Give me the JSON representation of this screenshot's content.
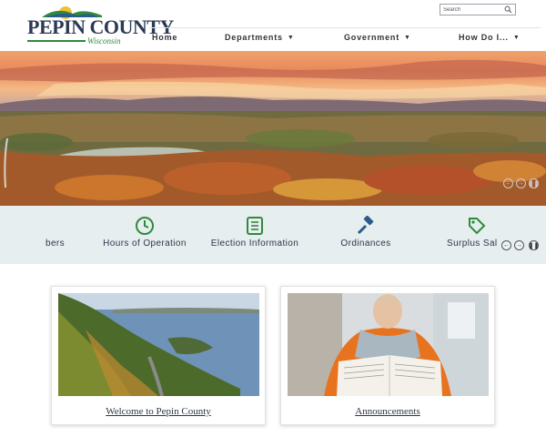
{
  "header": {
    "logo": {
      "title": "PEPIN COUNTY",
      "subtitle": "Wisconsin"
    },
    "search": {
      "placeholder": "Search",
      "icon": "search-icon"
    },
    "nav": [
      {
        "label": "Home",
        "has_dropdown": false
      },
      {
        "label": "Departments",
        "has_dropdown": true
      },
      {
        "label": "Government",
        "has_dropdown": true
      },
      {
        "label": "How Do I...",
        "has_dropdown": true
      }
    ]
  },
  "hero": {
    "controls": [
      "previous-icon",
      "next-icon",
      "pause-icon"
    ]
  },
  "quick_links": {
    "items": [
      {
        "label": "bers",
        "icon": "members-icon"
      },
      {
        "label": "Hours of Operation",
        "icon": "clock-icon"
      },
      {
        "label": "Election Information",
        "icon": "list-icon"
      },
      {
        "label": "Ordinances",
        "icon": "gavel-icon"
      },
      {
        "label": "Surplus Sal",
        "icon": "tag-icon"
      }
    ],
    "controls": [
      "previous-icon",
      "next-icon",
      "pause-icon"
    ]
  },
  "cards": [
    {
      "caption": "Welcome to Pepin County",
      "image": "river-valley-photo"
    },
    {
      "caption": "Announcements",
      "image": "newspaper-reader-photo"
    }
  ],
  "colors": {
    "accent_green": "#2f8a3b",
    "accent_blue": "#2b5b8a",
    "band": "#e6eeef",
    "text": "#2d3748"
  }
}
